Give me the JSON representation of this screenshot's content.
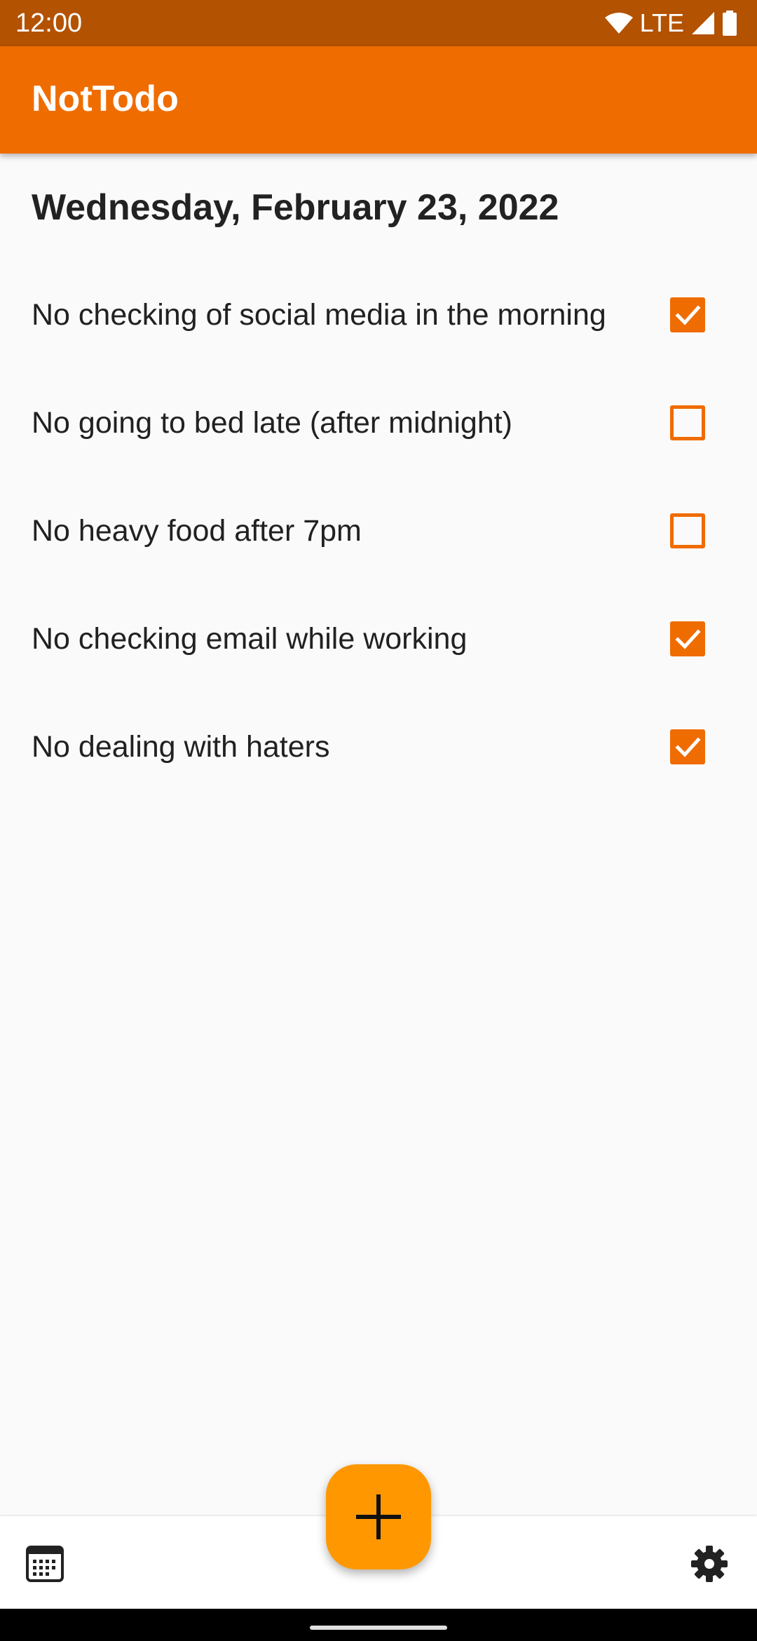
{
  "status_bar": {
    "time": "12:00",
    "network": "LTE",
    "icons": [
      "wifi-icon",
      "cell-signal-icon",
      "battery-icon"
    ]
  },
  "app_bar": {
    "title": "NotTodo"
  },
  "main": {
    "date": "Wednesday, February 23, 2022",
    "items": [
      {
        "label": "No checking of social media in the morning",
        "checked": true
      },
      {
        "label": "No going to bed late (after midnight)",
        "checked": false
      },
      {
        "label": "No heavy food after 7pm",
        "checked": false
      },
      {
        "label": "No checking email while working",
        "checked": true
      },
      {
        "label": "No dealing with haters",
        "checked": true
      }
    ]
  },
  "bottom_bar": {
    "left_icon": "calendar-icon",
    "fab_icon": "plus-icon",
    "right_icon": "gear-icon"
  },
  "colors": {
    "status_bar": "#b35200",
    "app_bar": "#ef6c00",
    "checkbox": "#ef6c00",
    "fab": "#ff9800",
    "background": "#fafafa"
  }
}
